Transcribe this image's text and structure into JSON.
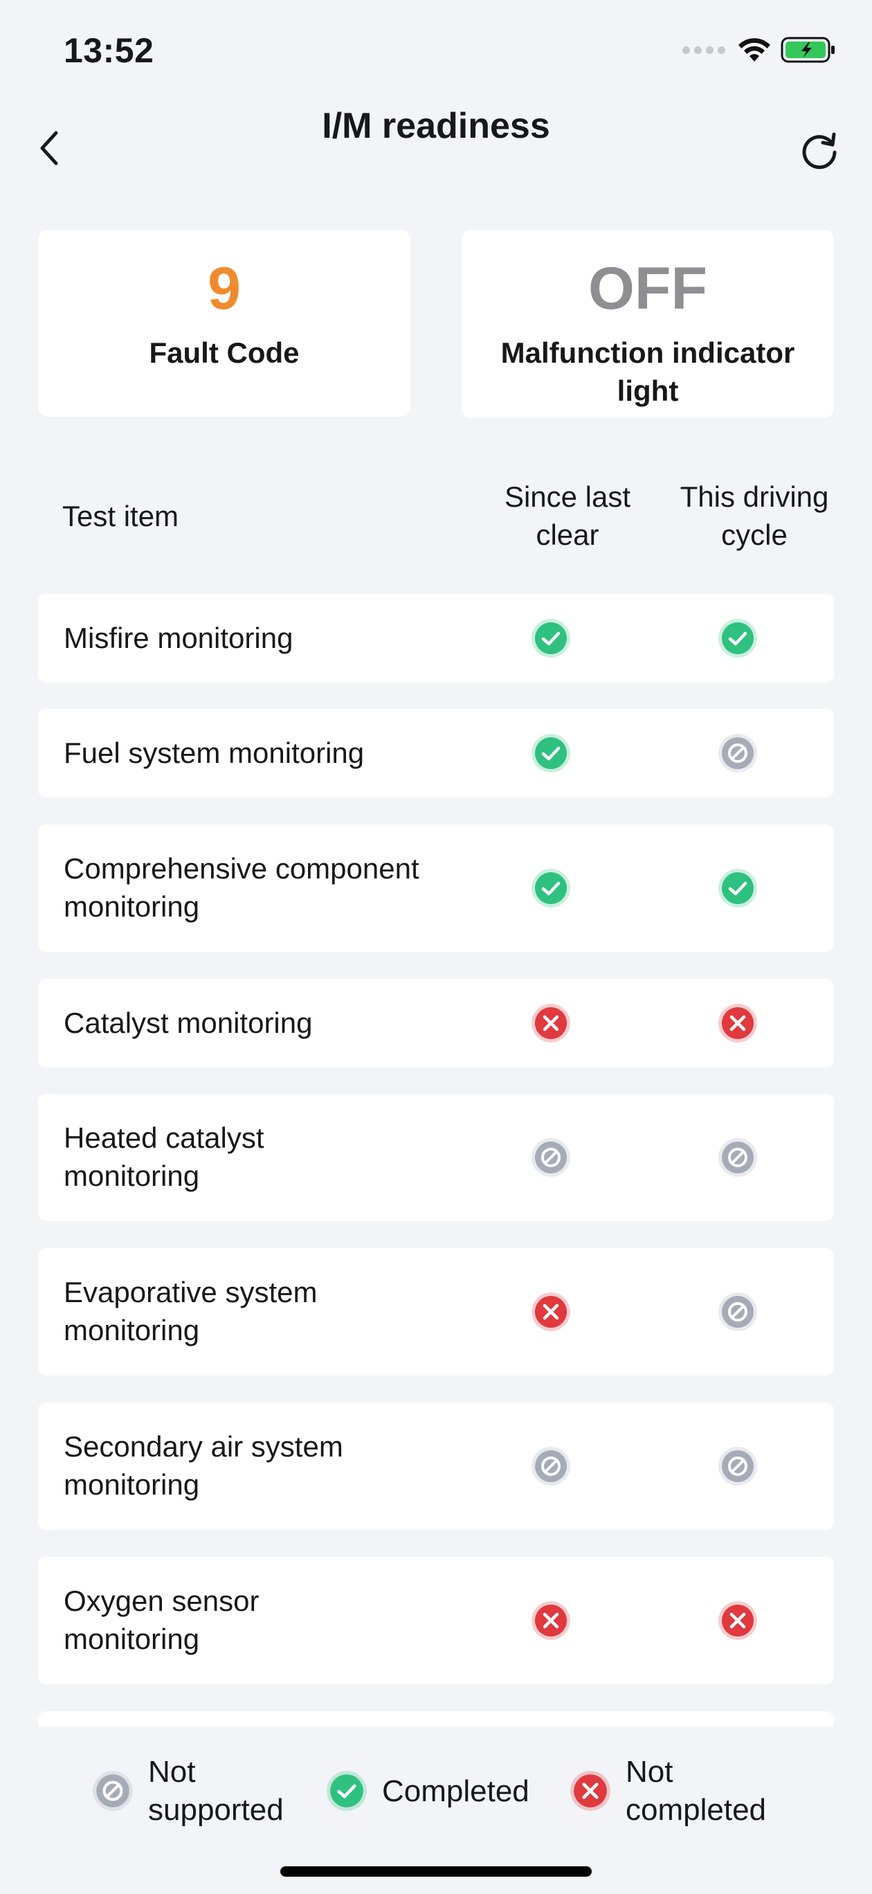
{
  "status_bar": {
    "time": "13:52"
  },
  "nav": {
    "title": "I/M readiness"
  },
  "summary": {
    "fault_code": {
      "value": "9",
      "label": "Fault Code"
    },
    "mil": {
      "value": "OFF",
      "label": "Malfunction indicator light"
    }
  },
  "table": {
    "header": {
      "item": "Test item",
      "since_last_clear": "Since last clear",
      "this_driving_cycle": "This driving cycle"
    },
    "rows": [
      {
        "label": "Misfire monitoring",
        "since": "completed",
        "cycle": "completed"
      },
      {
        "label": "Fuel system monitoring",
        "since": "completed",
        "cycle": "not_supported"
      },
      {
        "label": "Comprehensive component monitoring",
        "since": "completed",
        "cycle": "completed"
      },
      {
        "label": "Catalyst monitoring",
        "since": "not_completed",
        "cycle": "not_completed"
      },
      {
        "label": "Heated catalyst monitoring",
        "since": "not_supported",
        "cycle": "not_supported"
      },
      {
        "label": "Evaporative system monitoring",
        "since": "not_completed",
        "cycle": "not_supported"
      },
      {
        "label": "Secondary air system monitoring",
        "since": "not_supported",
        "cycle": "not_supported"
      },
      {
        "label": "Oxygen sensor monitoring",
        "since": "not_completed",
        "cycle": "not_completed"
      }
    ]
  },
  "legend": {
    "not_supported": "Not supported",
    "completed": "Completed",
    "not_completed": "Not completed"
  },
  "colors": {
    "fault_value": "#f08a2e",
    "mil_value": "#8e8e93",
    "completed": "#2fc17f",
    "not_completed": "#e0393e",
    "not_supported": "#a6abb8"
  }
}
